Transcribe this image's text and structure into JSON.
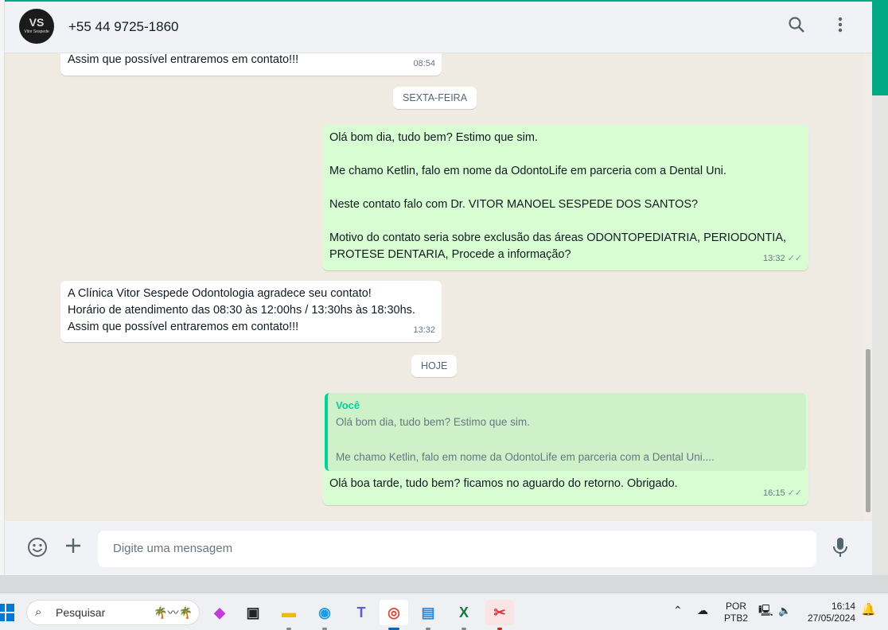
{
  "header": {
    "avatar_text": "VS",
    "avatar_subtext": "Vitor Sespede",
    "contact": "+55 44 9725-1860",
    "icons": [
      "search-icon",
      "menu-icon"
    ]
  },
  "messages": [
    {
      "type": "in",
      "text": "Assim que possível entraremos em contato!!!",
      "time": "08:54"
    },
    {
      "type": "date",
      "text": "SEXTA-FEIRA"
    },
    {
      "type": "out",
      "text": "Olá bom dia, tudo bem? Estimo que sim.\n\nMe chamo Ketlin, falo em nome da OdontoLife em parceria com a Dental Uni.\n\nNeste contato falo com Dr. VITOR MANOEL SESPEDE DOS SANTOS?\n\nMotivo do contato seria sobre exclusão das áreas ODONTOPEDIATRIA, PERIODONTIA,\nPROTESE DENTARIA, Procede a informação?",
      "time": "13:32"
    },
    {
      "type": "in",
      "text": "A Clínica Vitor Sespede Odontologia agradece seu contato!\nHorário de atendimento das 08:30 às 12:00hs / 13:30hs às 18:30hs.\nAssim que possível entraremos em contato!!!",
      "time": "13:32"
    },
    {
      "type": "date",
      "text": "HOJE"
    },
    {
      "type": "out",
      "quote_name": "Você",
      "quote_text": "Olá bom dia, tudo bem? Estimo que sim.\n\nMe chamo Ketlin, falo em nome da OdontoLife em parceria com a Dental Uni....",
      "text": "Olá boa tarde, tudo bem? ficamos no aguardo do retorno. Obrigado.",
      "time": "16:15"
    }
  ],
  "footer": {
    "placeholder": "Digite uma mensagem"
  },
  "taskbar": {
    "search": "Pesquisar",
    "lang1": "POR",
    "lang2": "PTB2",
    "time": "16:14",
    "date": "27/05/2024"
  },
  "colors": {
    "accent": "#00a884",
    "outgoing": "#d9fdd3",
    "chat_bg": "#efeae2"
  }
}
